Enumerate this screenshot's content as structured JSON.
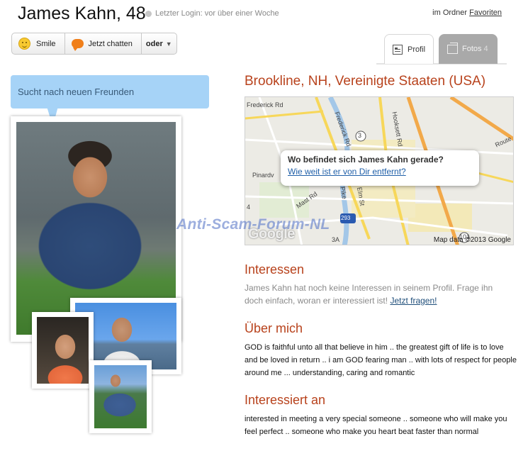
{
  "header": {
    "name_age": "James Kahn, 48",
    "last_login": "Letzter Login: vor über einer Woche",
    "folder_prefix": "im Ordner",
    "folder_link": "Favoriten"
  },
  "actions": {
    "smile": "Smile",
    "chat": "Jetzt chatten",
    "more": "oder"
  },
  "tabs": {
    "profil": "Profil",
    "fotos": "Fotos",
    "fotos_count": "4"
  },
  "status_bubble": "Sucht nach neuen Freunden",
  "watermark": "Anti-Scam-Forum-NL",
  "location": "Brookline, NH, Vereinigte Staaten (USA)",
  "map": {
    "popup_question": "Wo befindet sich James Kahn gerade?",
    "popup_link": "Wie weit ist er von Dir entfernt?",
    "logo": "Google",
    "attribution": "Map data ©2013 Google",
    "labels": {
      "frederick": "Frederick Rd",
      "hooksett": "Hooksett Rd",
      "pinardville": "Pinardv",
      "mast": "Mast Rd",
      "elm": "Elm St",
      "route": "Route",
      "pike": "Pike",
      "shield_3": "3",
      "shield_293": "293",
      "shield_3a": "3A",
      "shield_101": "101",
      "shield_4": "4"
    }
  },
  "interests": {
    "title": "Interessen",
    "text": "James Kahn hat noch keine Interessen in seinem Profil. Frage ihn doch einfach, woran er interessiert ist!",
    "link": "Jetzt fragen!"
  },
  "about": {
    "title": "Über mich",
    "text": "GOD is faithful unto all that believe in him .. the greatest gift of life is to love and be loved in return .. i am GOD fearing man .. with lots of respect for people around me ... understanding, caring and romantic"
  },
  "interested_in": {
    "title": "Interessiert an",
    "text": "interested in meeting a very special someone .. someone who will make you feel perfect .. someone who make you heart beat faster than normal"
  }
}
